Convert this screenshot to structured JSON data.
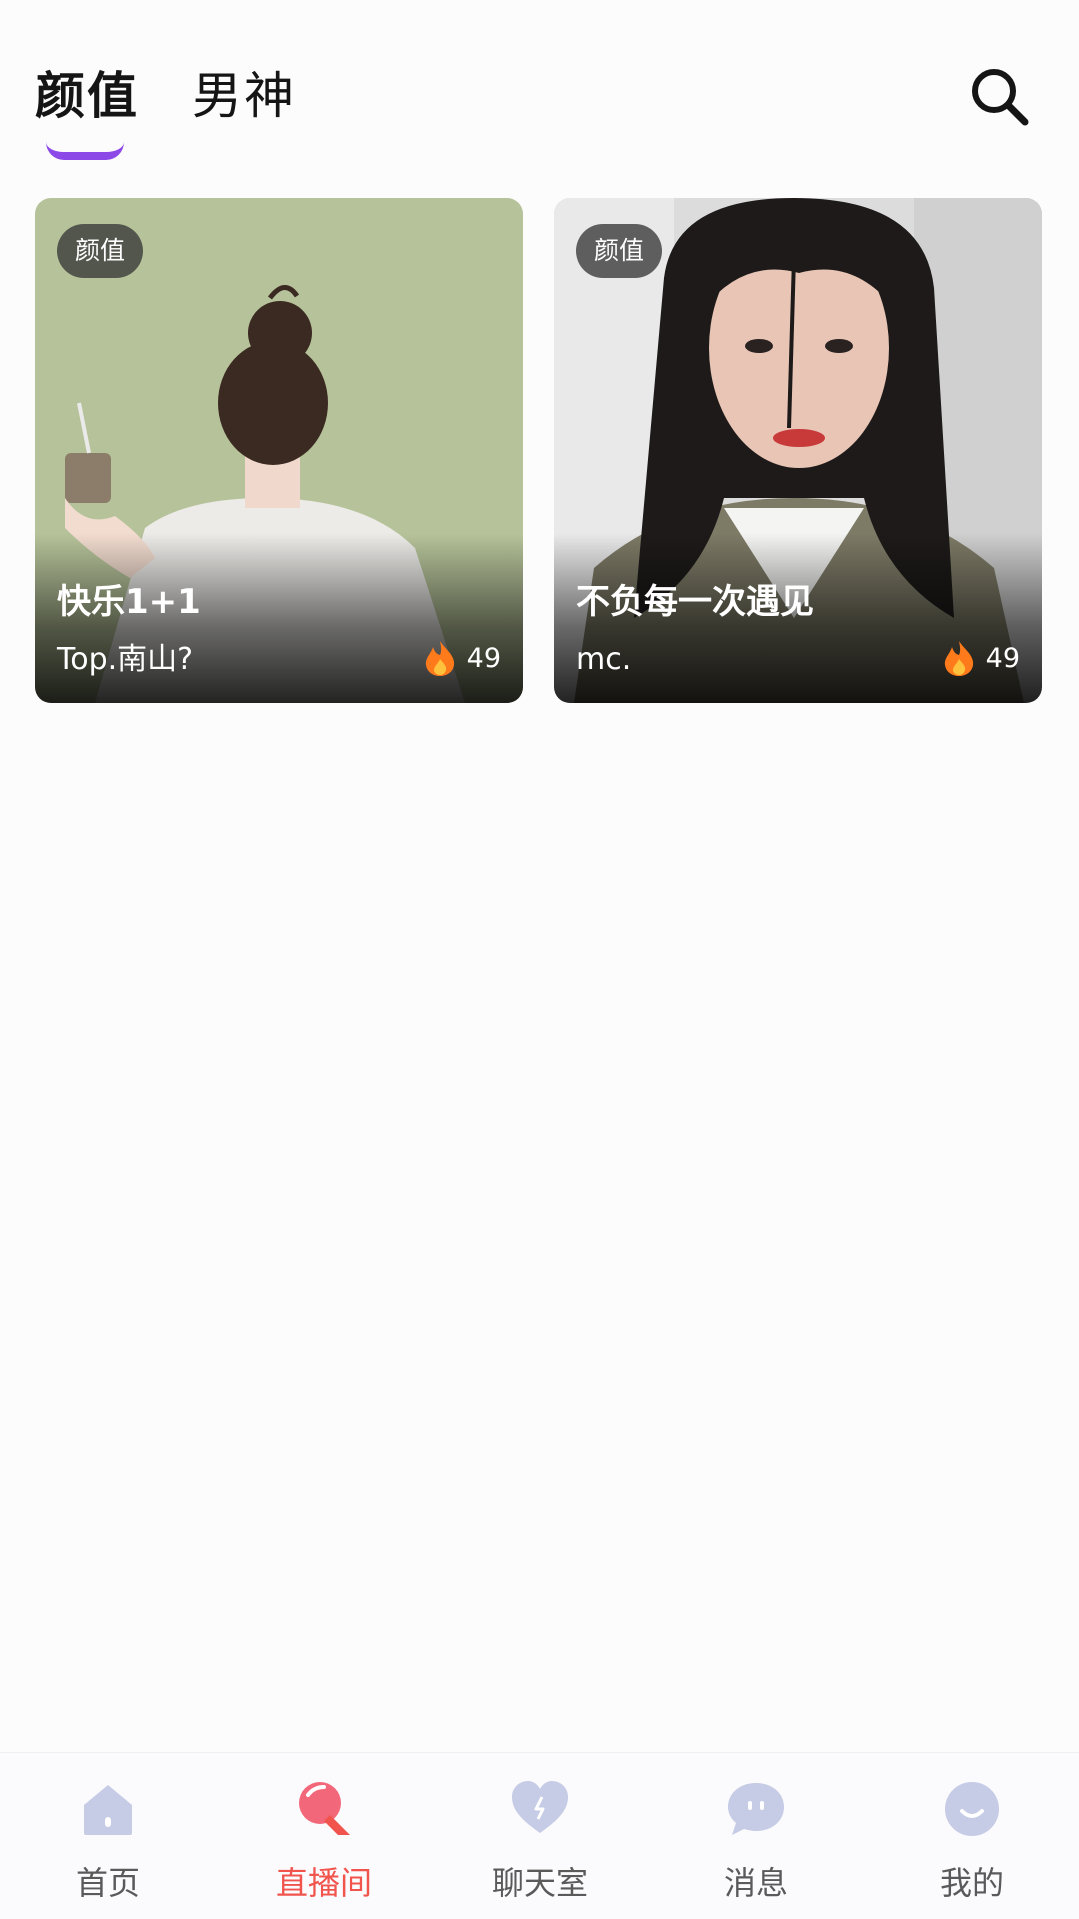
{
  "tabs": {
    "active": "颜值",
    "other": "男神"
  },
  "cards": [
    {
      "badge": "颜值",
      "title": "快乐1+1",
      "host": "Top.南山?",
      "heat": "49"
    },
    {
      "badge": "颜值",
      "title": "不负每一次遇见",
      "host": "mc.",
      "heat": "49"
    }
  ],
  "nav": [
    {
      "label": "首页",
      "icon": "home-icon"
    },
    {
      "label": "直播间",
      "icon": "live-mic-icon",
      "active": true
    },
    {
      "label": "聊天室",
      "icon": "chatroom-heart-icon"
    },
    {
      "label": "消息",
      "icon": "message-bubble-icon"
    },
    {
      "label": "我的",
      "icon": "profile-smile-icon"
    }
  ],
  "colors": {
    "accent_purple": "#8d49e8",
    "nav_active": "#f0544d",
    "nav_icon": "#c6cbe6",
    "flame": "#ff7a1a"
  }
}
